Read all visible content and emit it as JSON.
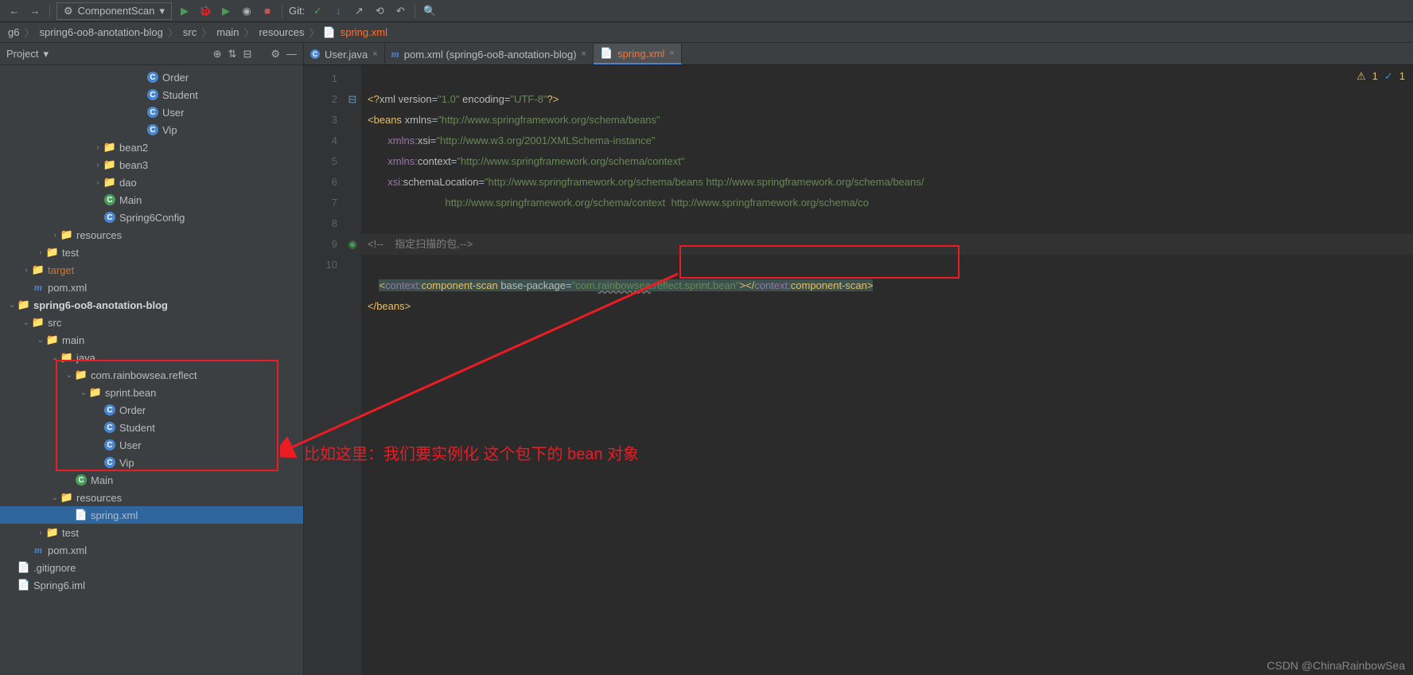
{
  "toolbar": {
    "combo": "ComponentScan",
    "git_label": "Git:"
  },
  "breadcrumb": [
    "g6",
    "spring6-oo8-anotation-blog",
    "src",
    "main",
    "resources",
    "spring.xml"
  ],
  "sidebar": {
    "title": "Project",
    "tree": [
      {
        "indent": 9,
        "icon": "class",
        "name": "Order"
      },
      {
        "indent": 9,
        "icon": "class",
        "name": "Student"
      },
      {
        "indent": 9,
        "icon": "class",
        "name": "User"
      },
      {
        "indent": 9,
        "icon": "class",
        "name": "Vip"
      },
      {
        "indent": 6,
        "arrow": "›",
        "icon": "folder",
        "name": "bean2"
      },
      {
        "indent": 6,
        "arrow": "›",
        "icon": "folder",
        "name": "bean3"
      },
      {
        "indent": 6,
        "arrow": "›",
        "icon": "folder",
        "name": "dao"
      },
      {
        "indent": 6,
        "icon": "class-g",
        "name": "Main"
      },
      {
        "indent": 6,
        "icon": "class",
        "name": "Spring6Config"
      },
      {
        "indent": 3,
        "arrow": "›",
        "icon": "folder-src",
        "name": "resources"
      },
      {
        "indent": 2,
        "arrow": "›",
        "icon": "folder",
        "name": "test"
      },
      {
        "indent": 1,
        "arrow": "›",
        "icon": "folder",
        "name": "target",
        "orange": true
      },
      {
        "indent": 1,
        "icon": "pom",
        "name": "pom.xml"
      },
      {
        "indent": 0,
        "arrow": "⌄",
        "icon": "folder",
        "name": "spring6-oo8-anotation-blog",
        "bold": true
      },
      {
        "indent": 1,
        "arrow": "⌄",
        "icon": "folder",
        "name": "src"
      },
      {
        "indent": 2,
        "arrow": "⌄",
        "icon": "folder",
        "name": "main"
      },
      {
        "indent": 3,
        "arrow": "⌄",
        "icon": "folder-src",
        "name": "java"
      },
      {
        "indent": 4,
        "arrow": "⌄",
        "icon": "folder",
        "name": "com.rainbowsea.reflect"
      },
      {
        "indent": 5,
        "arrow": "⌄",
        "icon": "folder",
        "name": "sprint.bean"
      },
      {
        "indent": 6,
        "icon": "class",
        "name": "Order"
      },
      {
        "indent": 6,
        "icon": "class",
        "name": "Student"
      },
      {
        "indent": 6,
        "icon": "class",
        "name": "User"
      },
      {
        "indent": 6,
        "icon": "class",
        "name": "Vip"
      },
      {
        "indent": 4,
        "icon": "class-g",
        "name": "Main"
      },
      {
        "indent": 3,
        "arrow": "⌄",
        "icon": "folder-src",
        "name": "resources"
      },
      {
        "indent": 4,
        "icon": "xml",
        "name": "spring.xml",
        "selected": true
      },
      {
        "indent": 2,
        "arrow": "›",
        "icon": "folder",
        "name": "test"
      },
      {
        "indent": 1,
        "icon": "pom",
        "name": "pom.xml"
      },
      {
        "indent": 0,
        "icon": "file",
        "name": ".gitignore"
      },
      {
        "indent": 0,
        "icon": "file",
        "name": "Spring6.iml"
      }
    ]
  },
  "tabs": [
    {
      "icon": "class",
      "label": "User.java"
    },
    {
      "icon": "pom",
      "label": "pom.xml (spring6-oo8-anotation-blog)"
    },
    {
      "icon": "xml",
      "label": "spring.xml",
      "active": true,
      "orange": true
    }
  ],
  "warnings": {
    "w1": "1",
    "w2": "1"
  },
  "code": {
    "l1": "<?xml version=\"1.0\" encoding=\"UTF-8\"?>",
    "l2": "<beans xmlns=\"http://www.springframework.org/schema/beans\"",
    "l3": "       xmlns:xsi=\"http://www.w3.org/2001/XMLSchema-instance\"",
    "l4": "       xmlns:context=\"http://www.springframework.org/schema/context\"",
    "l5": "       xsi:schemaLocation=\"http://www.springframework.org/schema/beans http://www.springframework.org/schema/beans/",
    "l6": "                           http://www.springframework.org/schema/context  http://www.springframework.org/schema/co",
    "l8_comment": "<!--    指定扫描的包,-->",
    "l9_tag_open": "<context:component-scan",
    "l9_attr": "base-package",
    "l9_val": "\"com.rainbowsea.reflect.sprint.bean\"",
    "l9_tag_close": "></context:component-scan>",
    "l10": "</beans>"
  },
  "annotation": "比如这里：我们要实例化 这个包下的 bean 对象",
  "watermark": "CSDN @ChinaRainbowSea"
}
